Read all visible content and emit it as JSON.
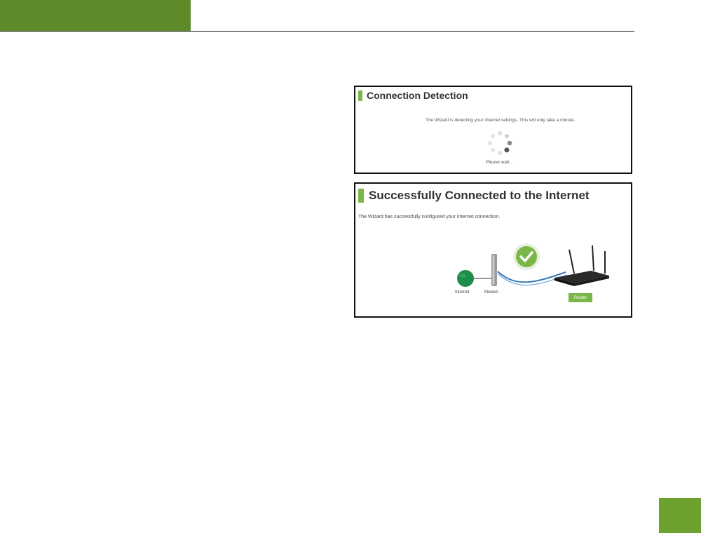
{
  "colors": {
    "header_green": "#5e8a2a",
    "accent_green": "#7ab648",
    "badge_green": "#6ca130",
    "globe_green": "#1e8c4a",
    "cable_blue": "#3a7ab8"
  },
  "detection": {
    "title": "Connection Detection",
    "message": "The Wizard is detecting your Internet settings. This will only take a minute.",
    "wait": "Please wait..."
  },
  "success": {
    "title": "Successfully Connected to the Internet",
    "message": "The Wizard has successfully configured your Internet connection.",
    "labels": {
      "internet": "Internet",
      "modem": "Modem",
      "router": "Router"
    },
    "icons": {
      "internet": "globe-icon",
      "modem": "modem-icon",
      "router": "router-icon",
      "status": "checkmark-icon"
    }
  }
}
